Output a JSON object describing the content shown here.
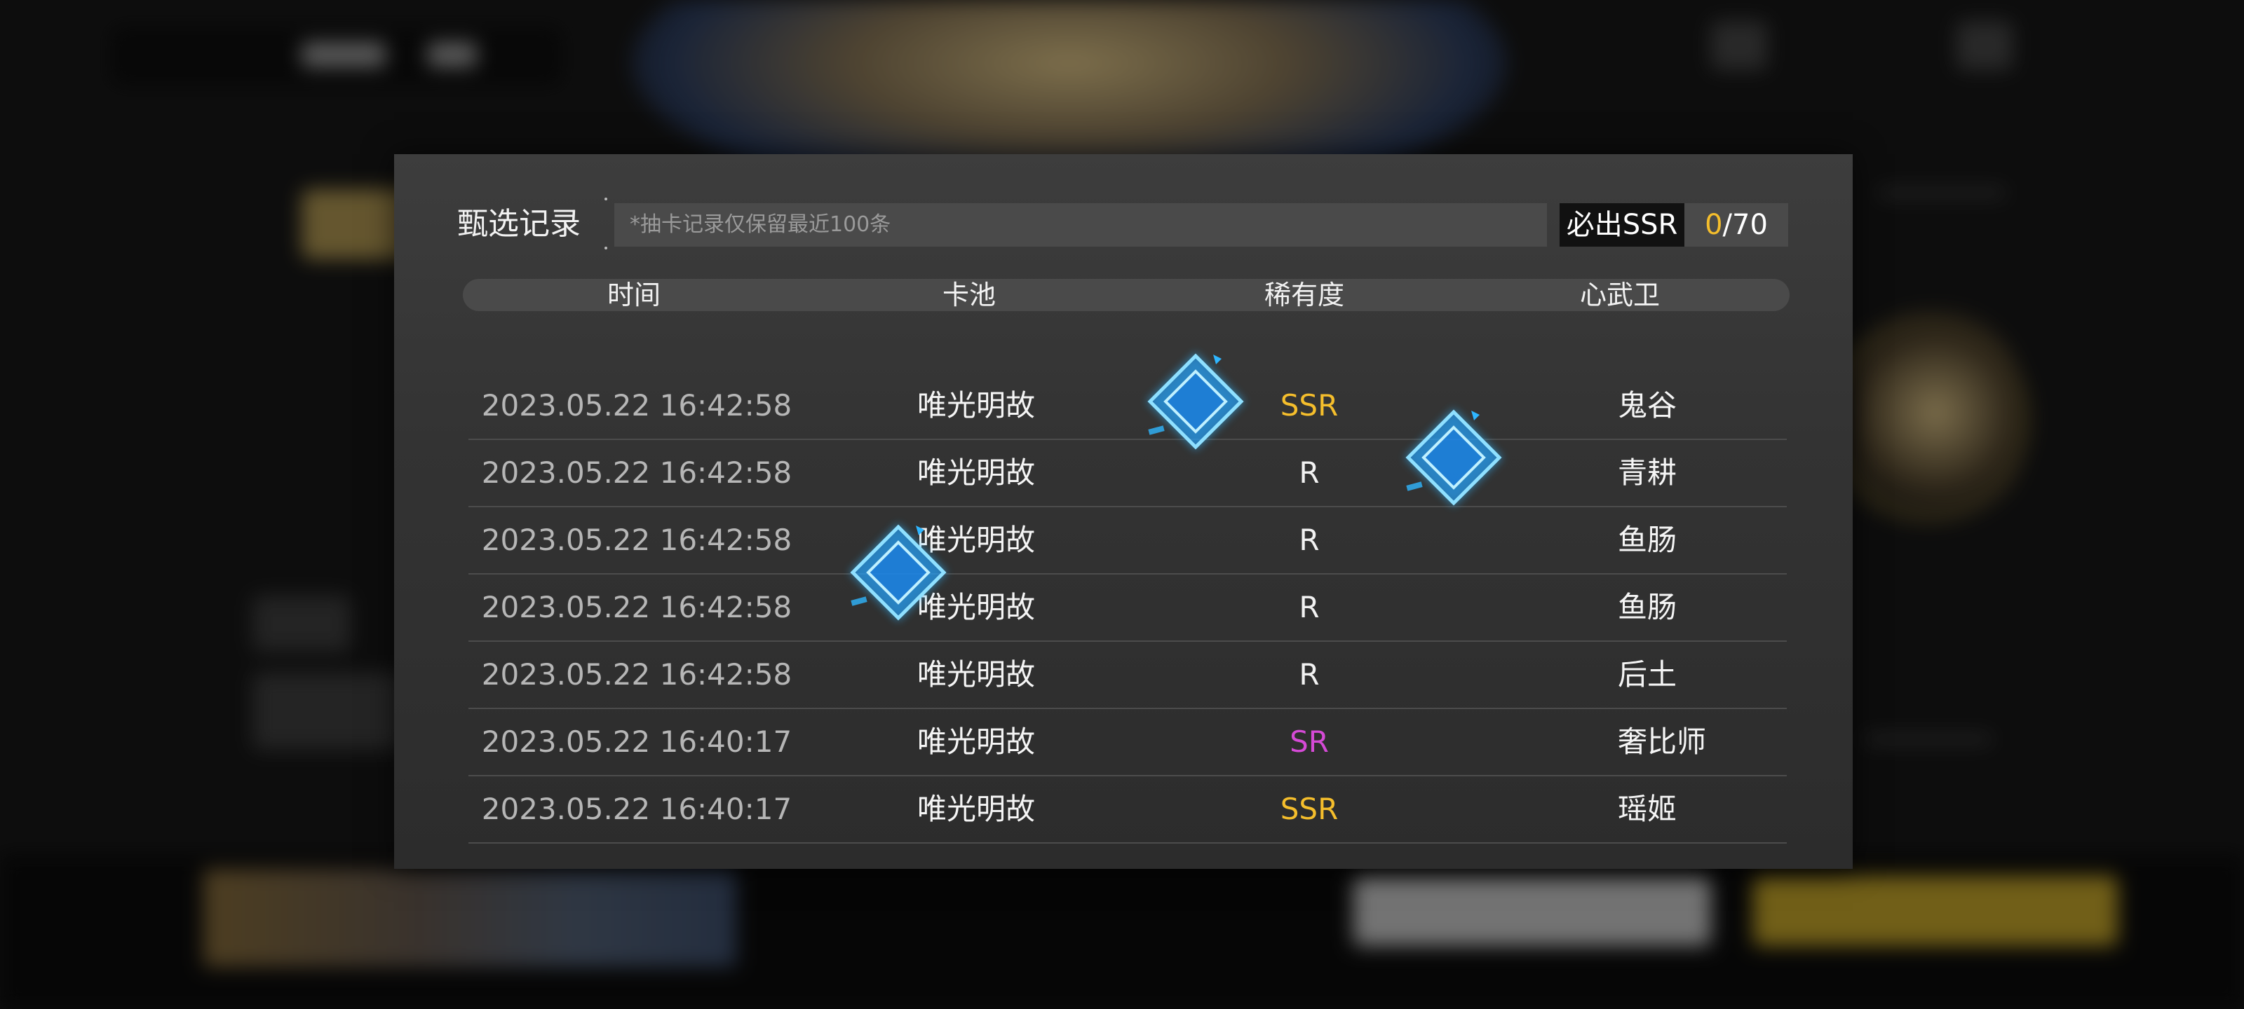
{
  "dialog": {
    "title": "甄选记录",
    "notice": "*抽卡记录仅保留最近100条",
    "pity_label": "必出SSR",
    "pity_current": "0",
    "pity_total": "/70"
  },
  "table": {
    "columns": [
      "时间",
      "卡池",
      "稀有度",
      "心武卫"
    ],
    "rows": [
      {
        "time": "2023.05.22  16:42:58",
        "pool": "唯光明故",
        "rarity": "SSR",
        "rarity_color": "#f5be2c",
        "character": "鬼谷"
      },
      {
        "time": "2023.05.22  16:42:58",
        "pool": "唯光明故",
        "rarity": "R",
        "rarity_color": "#f2f2f2",
        "character": "青耕"
      },
      {
        "time": "2023.05.22  16:42:58",
        "pool": "唯光明故",
        "rarity": "R",
        "rarity_color": "#f2f2f2",
        "character": "鱼肠"
      },
      {
        "time": "2023.05.22  16:42:58",
        "pool": "唯光明故",
        "rarity": "R",
        "rarity_color": "#f2f2f2",
        "character": "鱼肠"
      },
      {
        "time": "2023.05.22  16:42:58",
        "pool": "唯光明故",
        "rarity": "R",
        "rarity_color": "#f2f2f2",
        "character": "后土"
      },
      {
        "time": "2023.05.22  16:40:17",
        "pool": "唯光明故",
        "rarity": "SR",
        "rarity_color": "#d54ad6",
        "character": "奢比师"
      },
      {
        "time": "2023.05.22  16:40:17",
        "pool": "唯光明故",
        "rarity": "SSR",
        "rarity_color": "#f5be2c",
        "character": "瑶姬"
      }
    ]
  },
  "colors": {
    "ssr": "#f5be2c",
    "sr": "#d54ad6",
    "r": "#f2f2f2",
    "crystal": "#2fb6ff"
  },
  "decorations": [
    "blue-crystal-icon",
    "blue-crystal-icon",
    "blue-crystal-icon"
  ]
}
